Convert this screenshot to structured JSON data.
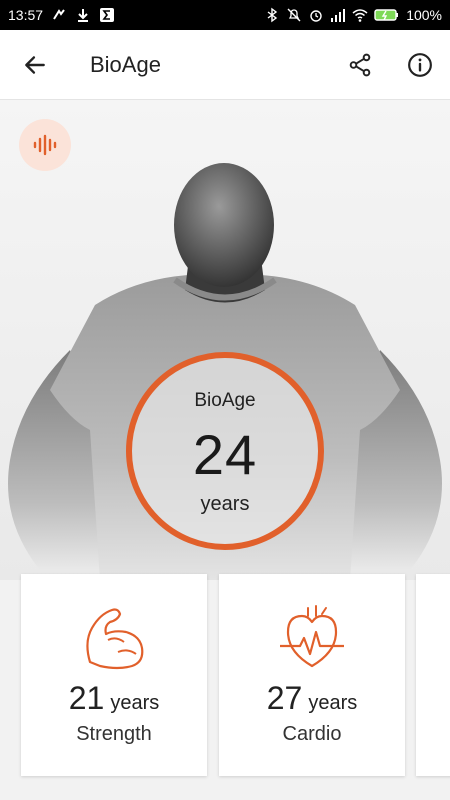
{
  "status_bar": {
    "time": "13:57",
    "battery": "100%",
    "icons": [
      "notification-icon",
      "download-icon",
      "sigma-icon",
      "bluetooth-icon",
      "mute-icon",
      "alarm-icon",
      "signal-icon",
      "wifi-icon",
      "battery-icon"
    ]
  },
  "app_bar": {
    "title": "BioAge",
    "icons": [
      "back-arrow-icon",
      "share-icon",
      "info-icon"
    ]
  },
  "hero": {
    "audio_icon": "audio-wave-icon",
    "ring_label": "BioAge",
    "ring_value": "24",
    "ring_unit": "years",
    "accent_color": "#e1602b"
  },
  "cards": [
    {
      "icon": "muscle-arm-icon",
      "value": "21",
      "unit": "years",
      "label": "Strength"
    },
    {
      "icon": "heart-pulse-icon",
      "value": "27",
      "unit": "years",
      "label": "Cardio"
    }
  ]
}
